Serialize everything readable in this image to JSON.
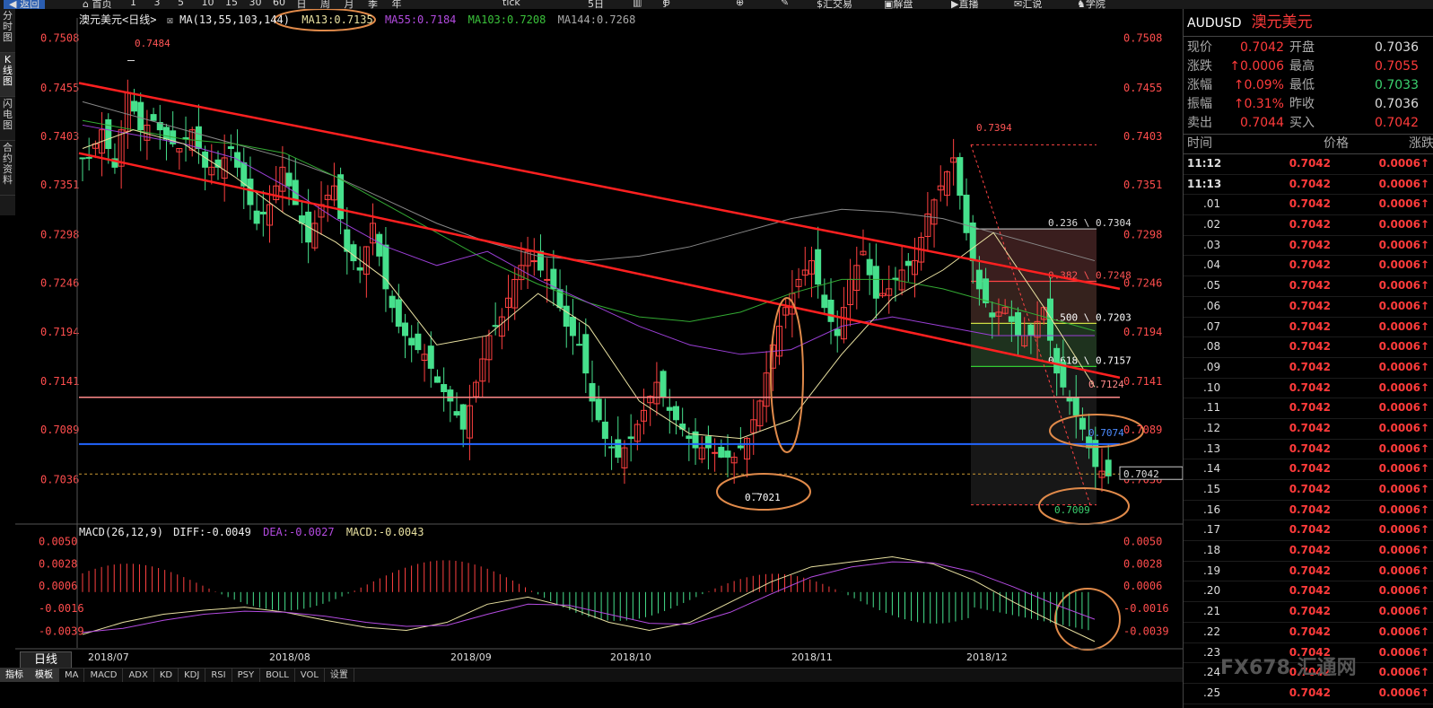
{
  "toolbar": {
    "back": "返回",
    "home": "首页",
    "periods": [
      "1",
      "3",
      "5",
      "10",
      "15",
      "30",
      "60",
      "日",
      "周",
      "月",
      "季",
      "年"
    ],
    "tick": "tick",
    "items": [
      "5日",
      "汇交易",
      "解盘",
      "直播",
      "汇说",
      "学院"
    ]
  },
  "left_tabs": [
    "分时图",
    "K线图",
    "闪电图",
    "合约资料"
  ],
  "chart_header": {
    "title": "澳元美元<日线>",
    "ma_label": "MA(13,55,103,144)",
    "ma13": "MA13:0.7135",
    "ma55": "MA55:0.7184",
    "ma103": "MA103:0.7208",
    "ma144": "MA144:0.7268"
  },
  "price_axis": [
    "0.7508",
    "0.7455",
    "0.7403",
    "0.7351",
    "0.7298",
    "0.7246",
    "0.7194",
    "0.7141",
    "0.7089",
    "0.7036"
  ],
  "macd_axis": [
    "0.0050",
    "0.0028",
    "0.0006",
    "-0.0016",
    "-0.0039"
  ],
  "macd_header": {
    "label": "MACD(26,12,9)",
    "diff": "DIFF:-0.0049",
    "dea": "DEA:-0.0027",
    "macd": "MACD:-0.0043"
  },
  "date_axis": [
    "2018/07",
    "2018/08",
    "2018/09",
    "2018/10",
    "2018/11",
    "2018/12"
  ],
  "annotations": {
    "high_label": "0.7484",
    "peak_label": "0.7394",
    "low_oct": "0.7021",
    "low_dec": "0.7009",
    "resist_label": "0.7124",
    "support_label": "0.7074",
    "last_price": "0.7042",
    "fib": [
      "0.236 \\ 0.7304",
      "0.382 \\ 0.7248",
      "0.500 \\ 0.7203",
      "0.618 \\ 0.7157"
    ]
  },
  "chart_data": {
    "type": "candlestick",
    "title": "澳元美元<日线>",
    "ylim": [
      0.7,
      0.752
    ],
    "x_labels": [
      "2018/07",
      "2018/08",
      "2018/09",
      "2018/10",
      "2018/11",
      "2018/12"
    ],
    "close_path": [
      0.738,
      0.741,
      0.737,
      0.745,
      0.741,
      0.742,
      0.74,
      0.739,
      0.741,
      0.737,
      0.737,
      0.739,
      0.735,
      0.731,
      0.733,
      0.737,
      0.733,
      0.729,
      0.733,
      0.735,
      0.728,
      0.726,
      0.731,
      0.724,
      0.72,
      0.718,
      0.717,
      0.714,
      0.712,
      0.709,
      0.714,
      0.719,
      0.721,
      0.725,
      0.728,
      0.726,
      0.724,
      0.72,
      0.718,
      0.712,
      0.708,
      0.706,
      0.708,
      0.711,
      0.714,
      0.711,
      0.709,
      0.707,
      0.707,
      0.706,
      0.706,
      0.708,
      0.712,
      0.718,
      0.722,
      0.725,
      0.727,
      0.722,
      0.719,
      0.725,
      0.728,
      0.723,
      0.724,
      0.726,
      0.727,
      0.732,
      0.735,
      0.738,
      0.73,
      0.724,
      0.721,
      0.722,
      0.719,
      0.719,
      0.722,
      0.715,
      0.712,
      0.709,
      0.705,
      0.704
    ],
    "high_marker": 0.7484,
    "peak_marker": 0.7394,
    "oct_low": 0.7021,
    "dec_low": 0.7009,
    "resistance": 0.7124,
    "support": 0.7074,
    "last": 0.7042,
    "fib_levels": [
      0.7304,
      0.7248,
      0.7203,
      0.7157
    ],
    "ma_values": {
      "MA13": 0.7135,
      "MA55": 0.7184,
      "MA103": 0.7208,
      "MA144": 0.7268
    },
    "macd": {
      "DIFF": -0.0049,
      "DEA": -0.0027,
      "MACD": -0.0043,
      "ylim": [
        -0.005,
        0.0055
      ]
    },
    "colors": {
      "up": "#ff4040",
      "down": "#46e08c",
      "ma13": "#e8e0a0",
      "ma55": "#9b3fd6",
      "ma103": "#33aa33",
      "ma144": "#888888",
      "channel": "#ff2020",
      "support": "#2266ff",
      "resist": "#ff8a8a",
      "ellipse": "#e08a4a"
    }
  },
  "quote": {
    "code": "AUDUSD",
    "name": "澳元美元",
    "rows": [
      {
        "l1": "现价",
        "v1": "0.7042",
        "c1": "up",
        "l2": "开盘",
        "v2": "0.7036",
        "c2": "wht"
      },
      {
        "l1": "涨跌",
        "v1": "↑0.0006",
        "c1": "up",
        "l2": "最高",
        "v2": "0.7055",
        "c2": "up"
      },
      {
        "l1": "涨幅",
        "v1": "↑0.09%",
        "c1": "up",
        "l2": "最低",
        "v2": "0.7033",
        "c2": "grn"
      },
      {
        "l1": "振幅",
        "v1": "↑0.31%",
        "c1": "up",
        "l2": "昨收",
        "v2": "0.7036",
        "c2": "wht"
      },
      {
        "l1": "卖出",
        "v1": "0.7044",
        "c1": "up",
        "l2": "买入",
        "v2": "0.7042",
        "c2": "up"
      }
    ]
  },
  "ticks_header": {
    "time": "时间",
    "price": "价格",
    "change": "涨跌"
  },
  "ticks": [
    {
      "t": "11:12",
      "p": "0.7042",
      "c": "0.0006↑"
    },
    {
      "t": "11:13",
      "p": "0.7042",
      "c": "0.0006↑"
    },
    {
      "t": ".01",
      "p": "0.7042",
      "c": "0.0006↑"
    },
    {
      "t": ".02",
      "p": "0.7042",
      "c": "0.0006↑"
    },
    {
      "t": ".03",
      "p": "0.7042",
      "c": "0.0006↑"
    },
    {
      "t": ".04",
      "p": "0.7042",
      "c": "0.0006↑"
    },
    {
      "t": ".05",
      "p": "0.7042",
      "c": "0.0006↑"
    },
    {
      "t": ".06",
      "p": "0.7042",
      "c": "0.0006↑"
    },
    {
      "t": ".07",
      "p": "0.7042",
      "c": "0.0006↑"
    },
    {
      "t": ".08",
      "p": "0.7042",
      "c": "0.0006↑"
    },
    {
      "t": ".09",
      "p": "0.7042",
      "c": "0.0006↑"
    },
    {
      "t": ".10",
      "p": "0.7042",
      "c": "0.0006↑"
    },
    {
      "t": ".11",
      "p": "0.7042",
      "c": "0.0006↑"
    },
    {
      "t": ".12",
      "p": "0.7042",
      "c": "0.0006↑"
    },
    {
      "t": ".13",
      "p": "0.7042",
      "c": "0.0006↑"
    },
    {
      "t": ".14",
      "p": "0.7042",
      "c": "0.0006↑"
    },
    {
      "t": ".15",
      "p": "0.7042",
      "c": "0.0006↑"
    },
    {
      "t": ".16",
      "p": "0.7042",
      "c": "0.0006↑"
    },
    {
      "t": ".17",
      "p": "0.7042",
      "c": "0.0006↑"
    },
    {
      "t": ".18",
      "p": "0.7042",
      "c": "0.0006↑"
    },
    {
      "t": ".19",
      "p": "0.7042",
      "c": "0.0006↑"
    },
    {
      "t": ".20",
      "p": "0.7042",
      "c": "0.0006↑"
    },
    {
      "t": ".21",
      "p": "0.7042",
      "c": "0.0006↑"
    },
    {
      "t": ".22",
      "p": "0.7042",
      "c": "0.0006↑"
    },
    {
      "t": ".23",
      "p": "0.7042",
      "c": "0.0006↑"
    },
    {
      "t": ".24",
      "p": "0.7042",
      "c": "0.0006↑"
    },
    {
      "t": ".25",
      "p": "0.7042",
      "c": "0.0006↑"
    }
  ],
  "period_tab": "日线",
  "bottom_tabs": [
    "指标",
    "模板",
    "MA",
    "MACD",
    "ADX",
    "KD",
    "KDJ",
    "RSI",
    "PSY",
    "BOLL",
    "VOL",
    "设置"
  ],
  "watermark": "FX678 汇通网"
}
